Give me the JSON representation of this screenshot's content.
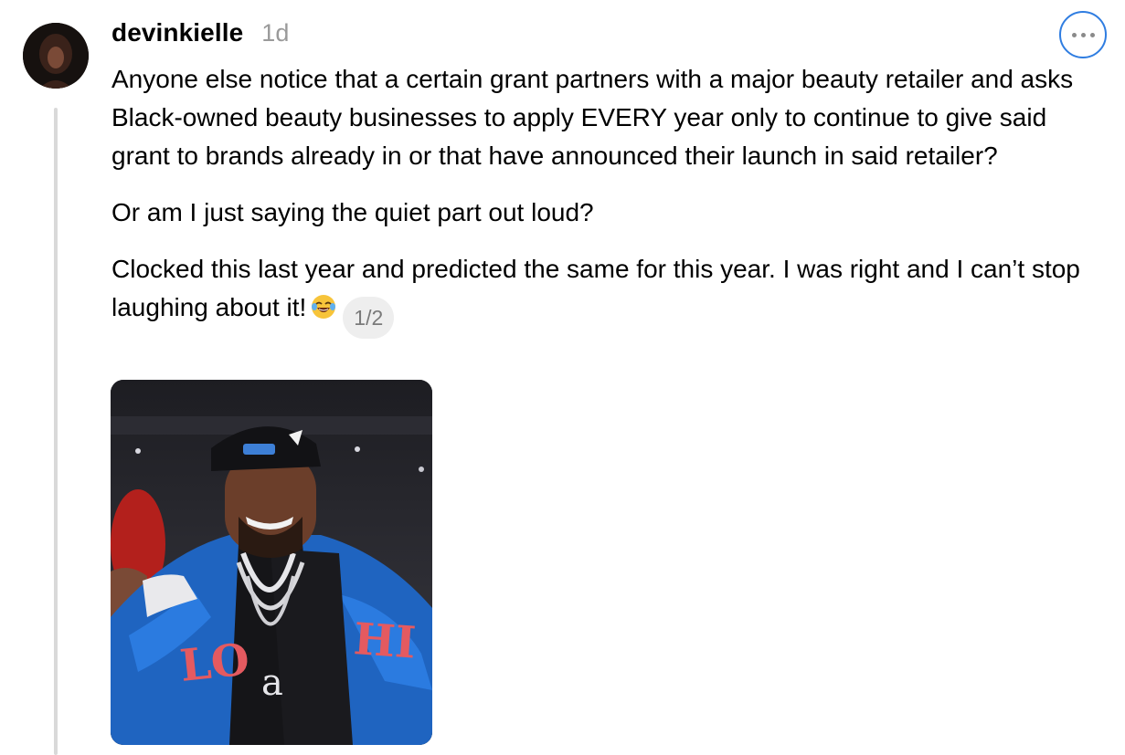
{
  "post": {
    "username": "devinkielle",
    "timestamp": "1d",
    "paragraphs": [
      "Anyone else notice that a certain grant partners with a major beauty retailer and asks Black-owned beauty businesses to apply EVERY year only to continue to give said grant to brands already in or that have announced their launch in said retailer?",
      "Or am I just saying the quiet part out loud?",
      "Clocked this last year and predicted the same for this year. I was right and I can’t stop laughing about it!"
    ],
    "emoji": "face-with-tears-of-joy",
    "page_counter": "1/2",
    "media_type": "gif"
  },
  "icons": {
    "more": "more-options-icon"
  },
  "colors": {
    "accent": "#2f7de1",
    "muted": "#9a9a9a",
    "thread_line": "#d9d9d9",
    "counter_bg": "#eeeeee"
  }
}
